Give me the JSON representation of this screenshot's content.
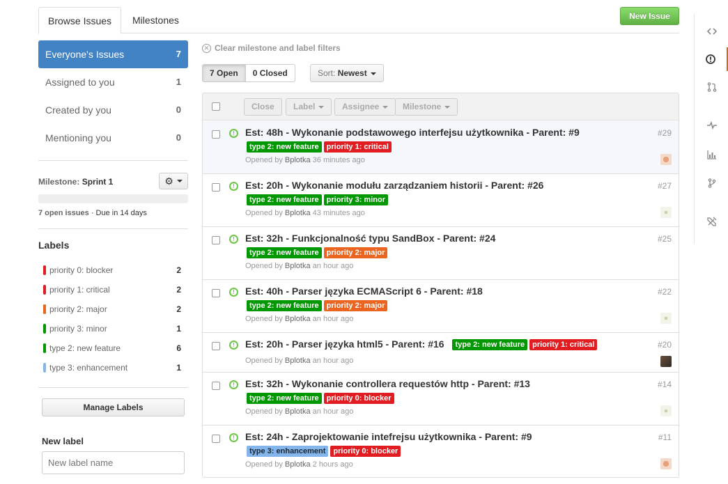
{
  "tabs": [
    {
      "label": "Browse Issues"
    },
    {
      "label": "Milestones"
    }
  ],
  "new_issue_label": "New Issue",
  "filters": [
    {
      "label": "Everyone's Issues",
      "count": "7"
    },
    {
      "label": "Assigned to you",
      "count": "1"
    },
    {
      "label": "Created by you",
      "count": "0"
    },
    {
      "label": "Mentioning you",
      "count": "0"
    }
  ],
  "milestone": {
    "prefix": "Milestone:",
    "name": "Sprint 1",
    "open_issues": "7 open issues",
    "due": " · Due in 14 days",
    "progress": 0
  },
  "labels_heading": "Labels",
  "labels": [
    {
      "name": "priority 0: blocker",
      "count": "2",
      "color": "#e11d21"
    },
    {
      "name": "priority 1: critical",
      "count": "2",
      "color": "#e11d21"
    },
    {
      "name": "priority 2: major",
      "count": "2",
      "color": "#eb6420"
    },
    {
      "name": "priority 3: minor",
      "count": "1",
      "color": "#009800"
    },
    {
      "name": "type 2: new feature",
      "count": "6",
      "color": "#009800"
    },
    {
      "name": "type 3: enhancement",
      "count": "1",
      "color": "#84b6eb"
    }
  ],
  "manage_labels": "Manage Labels",
  "new_label": {
    "heading": "New label",
    "placeholder": "New label name"
  },
  "clear_filters": "Clear milestone and label filters",
  "state": {
    "open": "7 Open",
    "closed": "0 Closed"
  },
  "sort": {
    "prefix": "Sort:",
    "value": "Newest"
  },
  "actions": {
    "close": "Close",
    "label": "Label",
    "assignee": "Assignee",
    "milestone": "Milestone"
  },
  "issues": [
    {
      "title": "Est: 48h - Wykonanie podstawowego interfejsu użytkownika - Parent: #9",
      "number": "#29",
      "author": "Bplotka",
      "time": "36 minutes ago",
      "tags": [
        {
          "text": "type 2: new feature",
          "color": "#009800"
        },
        {
          "text": "priority 1: critical",
          "color": "#e11d21"
        }
      ]
    },
    {
      "title": "Est: 20h - Wykonanie modułu zarządzaniem historii - Parent: #26",
      "number": "#27",
      "author": "Bplotka",
      "time": "43 minutes ago",
      "tags": [
        {
          "text": "type 2: new feature",
          "color": "#009800"
        },
        {
          "text": "priority 3: minor",
          "color": "#009800"
        }
      ]
    },
    {
      "title": "Est: 32h - Funkcjonalność typu SandBox - Parent: #24",
      "number": "#25",
      "author": "Bplotka",
      "time": "an hour ago",
      "tags": [
        {
          "text": "type 2: new feature",
          "color": "#009800"
        },
        {
          "text": "priority 2: major",
          "color": "#eb6420"
        }
      ]
    },
    {
      "title": "Est: 40h - Parser języka ECMAScript 6 - Parent: #18",
      "number": "#22",
      "author": "Bplotka",
      "time": "an hour ago",
      "tags": [
        {
          "text": "type 2: new feature",
          "color": "#009800"
        },
        {
          "text": "priority 2: major",
          "color": "#eb6420"
        }
      ]
    },
    {
      "title": "Est: 20h - Parser języka html5 - Parent: #16",
      "number": "#20",
      "author": "Bplotka",
      "time": "an hour ago",
      "tags": [
        {
          "text": "type 2: new feature",
          "color": "#009800"
        },
        {
          "text": "priority 1: critical",
          "color": "#e11d21"
        }
      ]
    },
    {
      "title": "Est: 32h - Wykonanie controllera requestów http - Parent: #13",
      "number": "#14",
      "author": "Bplotka",
      "time": "an hour ago",
      "tags": [
        {
          "text": "type 2: new feature",
          "color": "#009800"
        },
        {
          "text": "priority 0: blocker",
          "color": "#e11d21"
        }
      ]
    },
    {
      "title": "Est: 24h - Zaprojektowanie intefrejsu użytkownika - Parent: #9",
      "number": "#11",
      "author": "Bplotka",
      "time": "2 hours ago",
      "tags": [
        {
          "text": "type 3: enhancement",
          "color": "#84b6eb"
        },
        {
          "text": "priority 0: blocker",
          "color": "#e11d21"
        }
      ]
    }
  ],
  "opened_by": "Opened by",
  "repo_nav_icons": [
    "code-icon",
    "issues-icon",
    "pull-requests-icon",
    "pulse-icon",
    "graphs-icon",
    "network-icon",
    "settings-icon"
  ]
}
